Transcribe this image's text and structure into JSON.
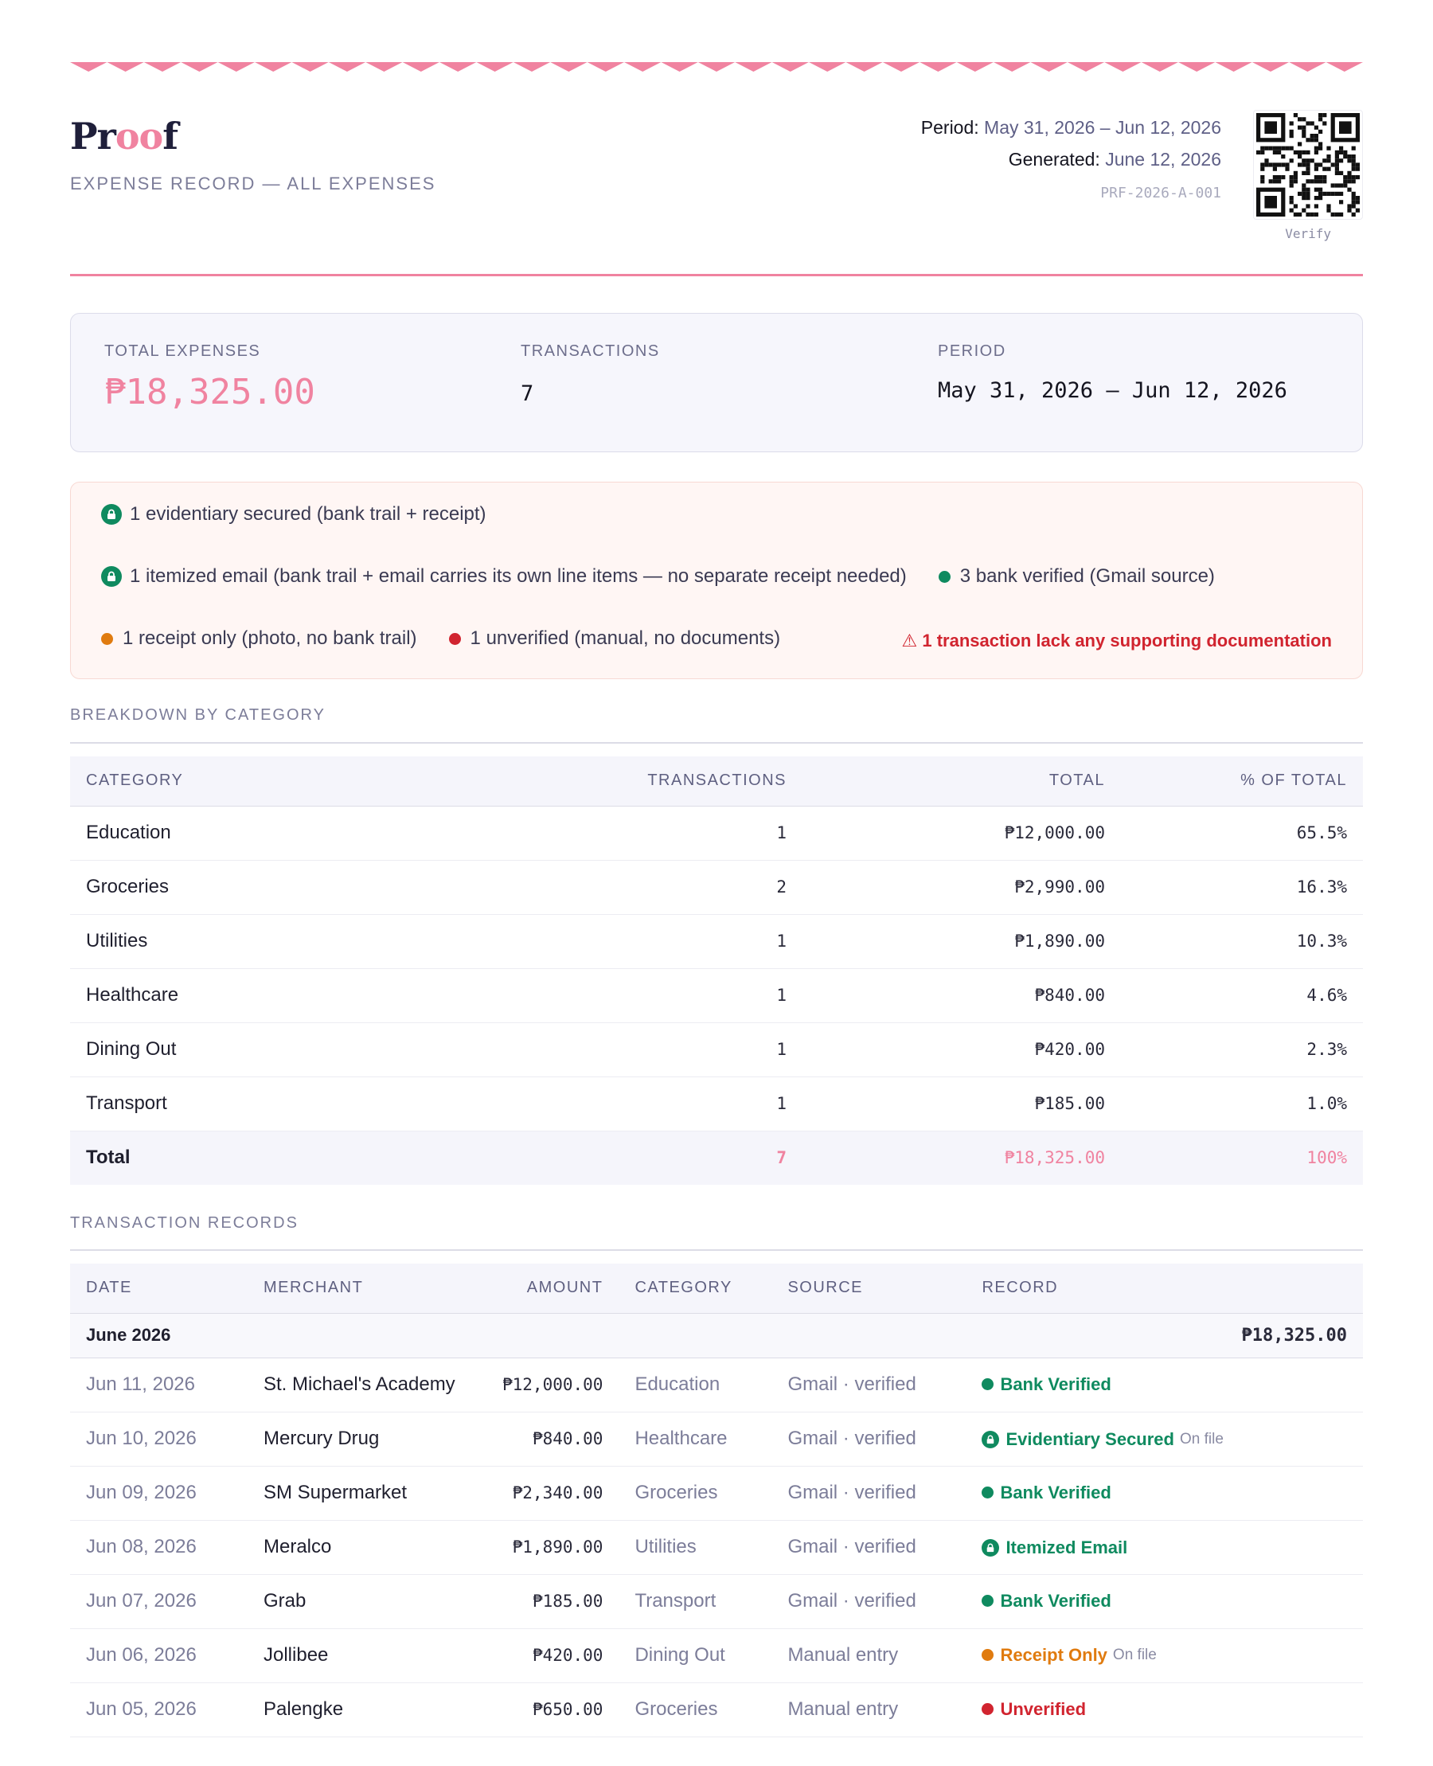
{
  "brand": {
    "prefix": "Pr",
    "highlight": "oo",
    "suffix": "f"
  },
  "document_subtitle": "EXPENSE RECORD — ALL EXPENSES",
  "meta": {
    "period_label": "Period:",
    "period_value": "May 31, 2026 – Jun 12, 2026",
    "generated_label": "Generated:",
    "generated_value": "June 12, 2026",
    "reference": "PRF-2026-A-001",
    "verify_label": "Verify"
  },
  "summary": {
    "total_label": "TOTAL EXPENSES",
    "total_value": "₱18,325.00",
    "transactions_label": "TRANSACTIONS",
    "transactions_value": "7",
    "period_label": "PERIOD",
    "period_value": "May 31, 2026 – Jun 12, 2026"
  },
  "status": {
    "evidentiary": "1 evidentiary secured (bank trail + receipt)",
    "itemized": "1 itemized email (bank trail + email carries its own line items — no separate receipt needed)",
    "bank_verified": "3 bank verified (Gmail source)",
    "receipt_only": "1 receipt only (photo, no bank trail)",
    "unverified": "1 unverified (manual, no documents)",
    "warning": "⚠ 1 transaction lack any supporting documentation"
  },
  "breakdown": {
    "title": "BREAKDOWN BY CATEGORY",
    "headers": [
      "CATEGORY",
      "TRANSACTIONS",
      "TOTAL",
      "% OF TOTAL"
    ],
    "rows": [
      {
        "category": "Education",
        "transactions": "1",
        "total": "₱12,000.00",
        "pct": "65.5%"
      },
      {
        "category": "Groceries",
        "transactions": "2",
        "total": "₱2,990.00",
        "pct": "16.3%"
      },
      {
        "category": "Utilities",
        "transactions": "1",
        "total": "₱1,890.00",
        "pct": "10.3%"
      },
      {
        "category": "Healthcare",
        "transactions": "1",
        "total": "₱840.00",
        "pct": "4.6%"
      },
      {
        "category": "Dining Out",
        "transactions": "1",
        "total": "₱420.00",
        "pct": "2.3%"
      },
      {
        "category": "Transport",
        "transactions": "1",
        "total": "₱185.00",
        "pct": "1.0%"
      }
    ],
    "total_row": {
      "label": "Total",
      "transactions": "7",
      "total": "₱18,325.00",
      "pct": "100%"
    }
  },
  "records": {
    "title": "TRANSACTION RECORDS",
    "headers": [
      "DATE",
      "MERCHANT",
      "AMOUNT",
      "CATEGORY",
      "SOURCE",
      "RECORD"
    ],
    "month_label": "June 2026",
    "month_total": "₱18,325.00",
    "rows": [
      {
        "date": "Jun 11, 2026",
        "merchant": "St. Michael's Academy",
        "amount": "₱12,000.00",
        "category": "Education",
        "source": "Gmail · verified",
        "record": "Bank Verified",
        "note": ""
      },
      {
        "date": "Jun 10, 2026",
        "merchant": "Mercury Drug",
        "amount": "₱840.00",
        "category": "Healthcare",
        "source": "Gmail · verified",
        "record": "Evidentiary Secured",
        "note": "On file"
      },
      {
        "date": "Jun 09, 2026",
        "merchant": "SM Supermarket",
        "amount": "₱2,340.00",
        "category": "Groceries",
        "source": "Gmail · verified",
        "record": "Bank Verified",
        "note": ""
      },
      {
        "date": "Jun 08, 2026",
        "merchant": "Meralco",
        "amount": "₱1,890.00",
        "category": "Utilities",
        "source": "Gmail · verified",
        "record": "Itemized Email",
        "note": ""
      },
      {
        "date": "Jun 07, 2026",
        "merchant": "Grab",
        "amount": "₱185.00",
        "category": "Transport",
        "source": "Gmail · verified",
        "record": "Bank Verified",
        "note": ""
      },
      {
        "date": "Jun 06, 2026",
        "merchant": "Jollibee",
        "amount": "₱420.00",
        "category": "Dining Out",
        "source": "Manual entry",
        "record": "Receipt Only",
        "note": "On file"
      },
      {
        "date": "Jun 05, 2026",
        "merchant": "Palengke",
        "amount": "₱650.00",
        "category": "Groceries",
        "source": "Manual entry",
        "record": "Unverified",
        "note": ""
      }
    ]
  },
  "colors": {
    "accent_pink": "#f083a0",
    "verified_green": "#0f8a5f",
    "receipt_orange": "#e07b0f",
    "unverified_red": "#d1242f"
  },
  "icons": {
    "lock": "lock-icon",
    "dot": "status-dot-icon",
    "warning": "warning-icon",
    "qr": "qr-code-icon"
  }
}
